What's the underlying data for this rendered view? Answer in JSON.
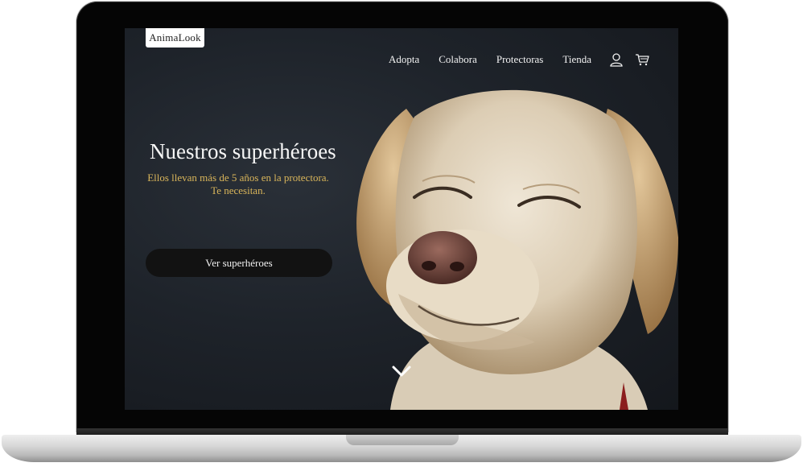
{
  "brand": {
    "logo_text": "AnimaLook"
  },
  "nav": {
    "items": [
      {
        "label": "Adopta"
      },
      {
        "label": "Colabora"
      },
      {
        "label": "Protectoras"
      },
      {
        "label": "Tienda"
      }
    ],
    "icons": [
      "user-icon",
      "cart-icon"
    ]
  },
  "hero": {
    "title": "Nuestros superhéroes",
    "subtitle_line1": "Ellos llevan más de 5 años en la protectora.",
    "subtitle_line2": "Te necesitan.",
    "cta_label": "Ver superhéroes",
    "scroll_icon": "chevron-down-icon",
    "image": "labrador-dog-photo"
  },
  "colors": {
    "background": "#1e232a",
    "accent_text": "#d9b55a",
    "button": "#121212",
    "text": "#f6f6f6"
  }
}
